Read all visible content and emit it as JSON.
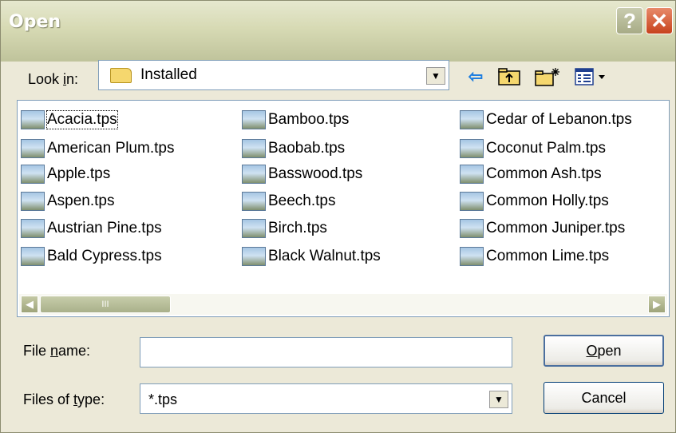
{
  "dialog": {
    "title": "Open",
    "help_label": "?",
    "close_label": "✕"
  },
  "look_in": {
    "label_prefix": "Look ",
    "label_mnemonic": "i",
    "label_suffix": "n:",
    "folder_name": "Installed",
    "toolbar": [
      "back-icon",
      "up-one-level-icon",
      "create-new-folder-icon",
      "view-menu-icon"
    ]
  },
  "files": [
    {
      "name": "Acacia.tps"
    },
    {
      "name": "American Plum.tps"
    },
    {
      "name": "Apple.tps"
    },
    {
      "name": "Aspen.tps"
    },
    {
      "name": "Austrian Pine.tps"
    },
    {
      "name": "Bald Cypress.tps"
    },
    {
      "name": "Bamboo.tps"
    },
    {
      "name": "Baobab.tps"
    },
    {
      "name": "Basswood.tps"
    },
    {
      "name": "Beech.tps"
    },
    {
      "name": "Birch.tps"
    },
    {
      "name": "Black Walnut.tps"
    },
    {
      "name": "Cedar of Lebanon.tps"
    },
    {
      "name": "Coconut Palm.tps"
    },
    {
      "name": "Common Ash.tps"
    },
    {
      "name": "Common Holly.tps"
    },
    {
      "name": "Common Juniper.tps"
    },
    {
      "name": "Common Lime.tps"
    }
  ],
  "file_name": {
    "label_prefix": "File ",
    "label_mnemonic": "n",
    "label_suffix": "ame:",
    "value": ""
  },
  "file_type": {
    "label_prefix": "Files of ",
    "label_mnemonic": "t",
    "label_suffix": "ype:",
    "value": "*.tps"
  },
  "buttons": {
    "open_mnemonic": "O",
    "open_rest": "pen",
    "cancel": "Cancel"
  },
  "scrollbar": {
    "left_arrow": "◀",
    "right_arrow": "▶",
    "thumb_grip": "III"
  },
  "colors": {
    "titlebar": "#D7DAB4",
    "dialog_bg": "#ECE9D8",
    "close_button": "#C7421C",
    "field_border": "#7F9DB9"
  }
}
